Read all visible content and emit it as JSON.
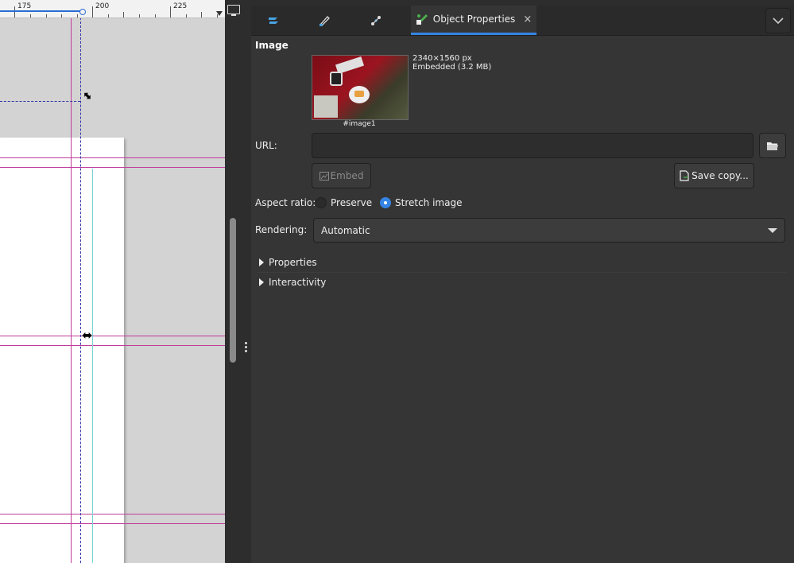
{
  "canvas": {
    "ruler_labels": [
      "175",
      "200",
      "225"
    ]
  },
  "tabs": [
    {
      "icon": "layers-icon",
      "label": ""
    },
    {
      "icon": "fill-stroke-icon",
      "label": ""
    },
    {
      "icon": "xml-editor-icon",
      "label": ""
    },
    {
      "icon": "object-properties-icon",
      "label": "Object Properties",
      "active": true
    }
  ],
  "tab_close": "×",
  "image_section": {
    "title": "Image",
    "size": "2340×1560 px",
    "embedded": "Embedded (3.2 MB)",
    "id": "#image1"
  },
  "url": {
    "label": "URL:",
    "value": ""
  },
  "buttons": {
    "embed": "Embed",
    "save_copy": "Save copy..."
  },
  "aspect": {
    "label": "Aspect ratio:",
    "options": [
      "Preserve",
      "Stretch image"
    ],
    "selected": "Stretch image"
  },
  "rendering": {
    "label": "Rendering:",
    "value": "Automatic"
  },
  "expanders": [
    "Properties",
    "Interactivity"
  ],
  "colors": {
    "accent": "#3584e4",
    "guide": "#c03c9a",
    "panel_bg": "#353535"
  }
}
